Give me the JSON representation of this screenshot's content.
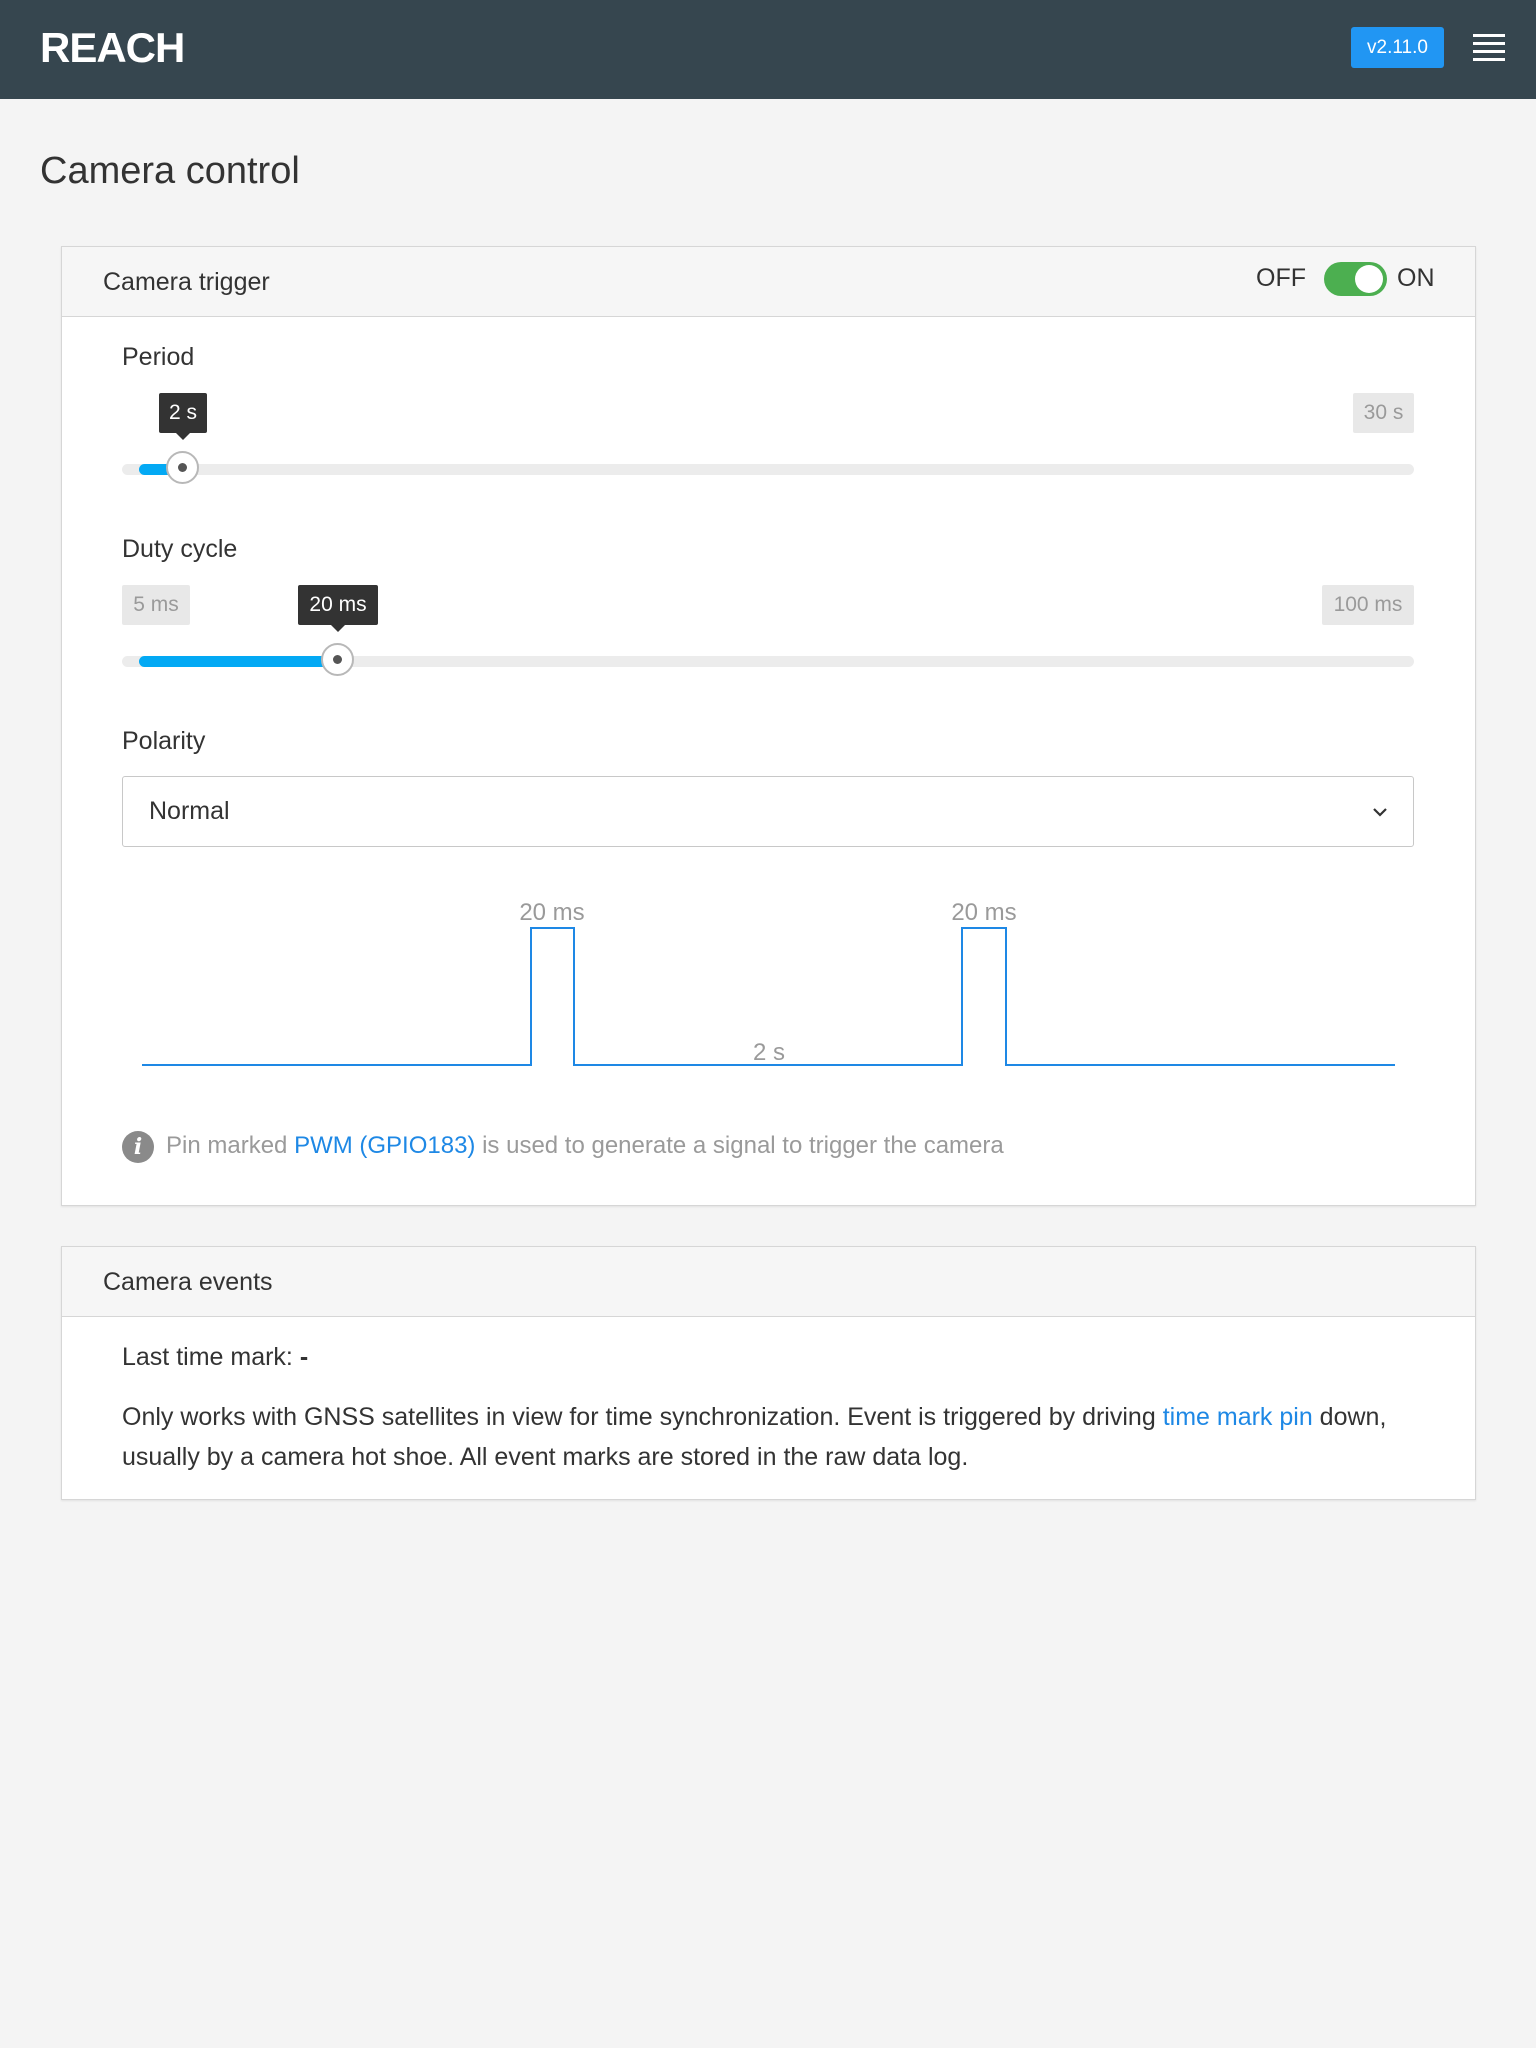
{
  "app": {
    "logo": "REACH",
    "version": "v2.11.0"
  },
  "page": {
    "title": "Camera control"
  },
  "camera_trigger": {
    "title": "Camera trigger",
    "toggle": {
      "off_label": "OFF",
      "on_label": "ON",
      "state": "on"
    },
    "period": {
      "label": "Period",
      "value_label": "2 s",
      "max_label": "30 s",
      "value": 2,
      "min": 0,
      "max": 30
    },
    "duty_cycle": {
      "label": "Duty cycle",
      "value_label": "20 ms",
      "min_label": "5 ms",
      "max_label": "100 ms",
      "value": 20,
      "min": 5,
      "max": 100
    },
    "polarity": {
      "label": "Polarity",
      "selected": "Normal"
    },
    "waveform": {
      "pulse_label_1": "20 ms",
      "pulse_label_2": "20 ms",
      "period_label": "2 s"
    },
    "info": {
      "text_before": "Pin marked ",
      "link": "PWM (GPIO183)",
      "text_after": " is used to generate a signal to trigger the camera"
    }
  },
  "camera_events": {
    "title": "Camera events",
    "last_mark_label": "Last time mark: ",
    "last_mark_value": "-",
    "desc_before": "Only works with GNSS satellites in view for time synchronization. Event is triggered by driving ",
    "desc_link": "time mark pin",
    "desc_after": " down, usually by a camera hot shoe. All event marks are stored in the raw data log."
  },
  "colors": {
    "topbar": "#36464f",
    "accent": "#03a9f4",
    "toggle_on": "#4caf50",
    "badge": "#2196f3",
    "link": "#1e88e5"
  }
}
